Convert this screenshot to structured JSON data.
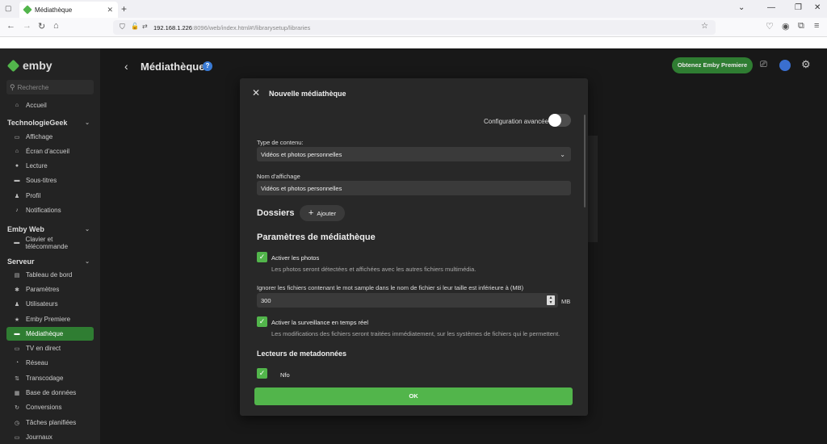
{
  "browser": {
    "tab_title": "Médiathèque",
    "url_host": "192.168.1.226",
    "url_rest": ":8096/web/index.html#!/librarysetup/libraries"
  },
  "app": {
    "logo": "emby",
    "search_placeholder": "Recherche",
    "page_title": "Médiathèque",
    "premium_button": "Obtenez Emby Premiere"
  },
  "sidebar": {
    "home": "Accueil",
    "sections": [
      {
        "title": "TechnologieGeek",
        "items": [
          "Affichage",
          "Écran d'accueil",
          "Lecture",
          "Sous-titres",
          "Profil",
          "Notifications"
        ]
      },
      {
        "title": "Emby Web",
        "items": [
          "Clavier et télécommande"
        ]
      },
      {
        "title": "Serveur",
        "items": [
          "Tableau de bord",
          "Paramètres",
          "Utilisateurs",
          "Emby Premiere",
          "Médiathèque",
          "TV en direct",
          "Réseau",
          "Transcodage",
          "Base de données",
          "Conversions",
          "Tâches planifiées",
          "Journaux"
        ]
      }
    ],
    "active_item": "Médiathèque"
  },
  "dialog": {
    "title": "Nouvelle médiathèque",
    "advanced_label": "Configuration avancée",
    "advanced_on": false,
    "content_type_label": "Type de contenu:",
    "content_type_value": "Vidéos et photos personnelles",
    "display_name_label": "Nom d'affichage",
    "display_name_value": "Vidéos et photos personnelles",
    "folders_label": "Dossiers",
    "add_button": "Ajouter",
    "params_label": "Paramètres de médiathèque",
    "enable_photos_label": "Activer les photos",
    "enable_photos_desc": "Les photos seront détectées et affichées avec les autres fichiers multimédia.",
    "ignore_label": "Ignorer les fichiers contenant le mot sample dans le nom de fichier si leur taille est inférieure à (MB)",
    "ignore_value": "300",
    "unit": "MB",
    "monitor_label": "Activer la surveillance en temps réel",
    "monitor_desc": "Les modifications des fichiers seront traitées immédiatement, sur les systèmes de fichiers qui le permettent.",
    "metadata_label": "Lecteurs de metadonnées",
    "nfo_label": "Nfo",
    "ok_button": "OK"
  },
  "colors": {
    "accent": "#52b54b",
    "active_bg": "#2f7d32"
  }
}
